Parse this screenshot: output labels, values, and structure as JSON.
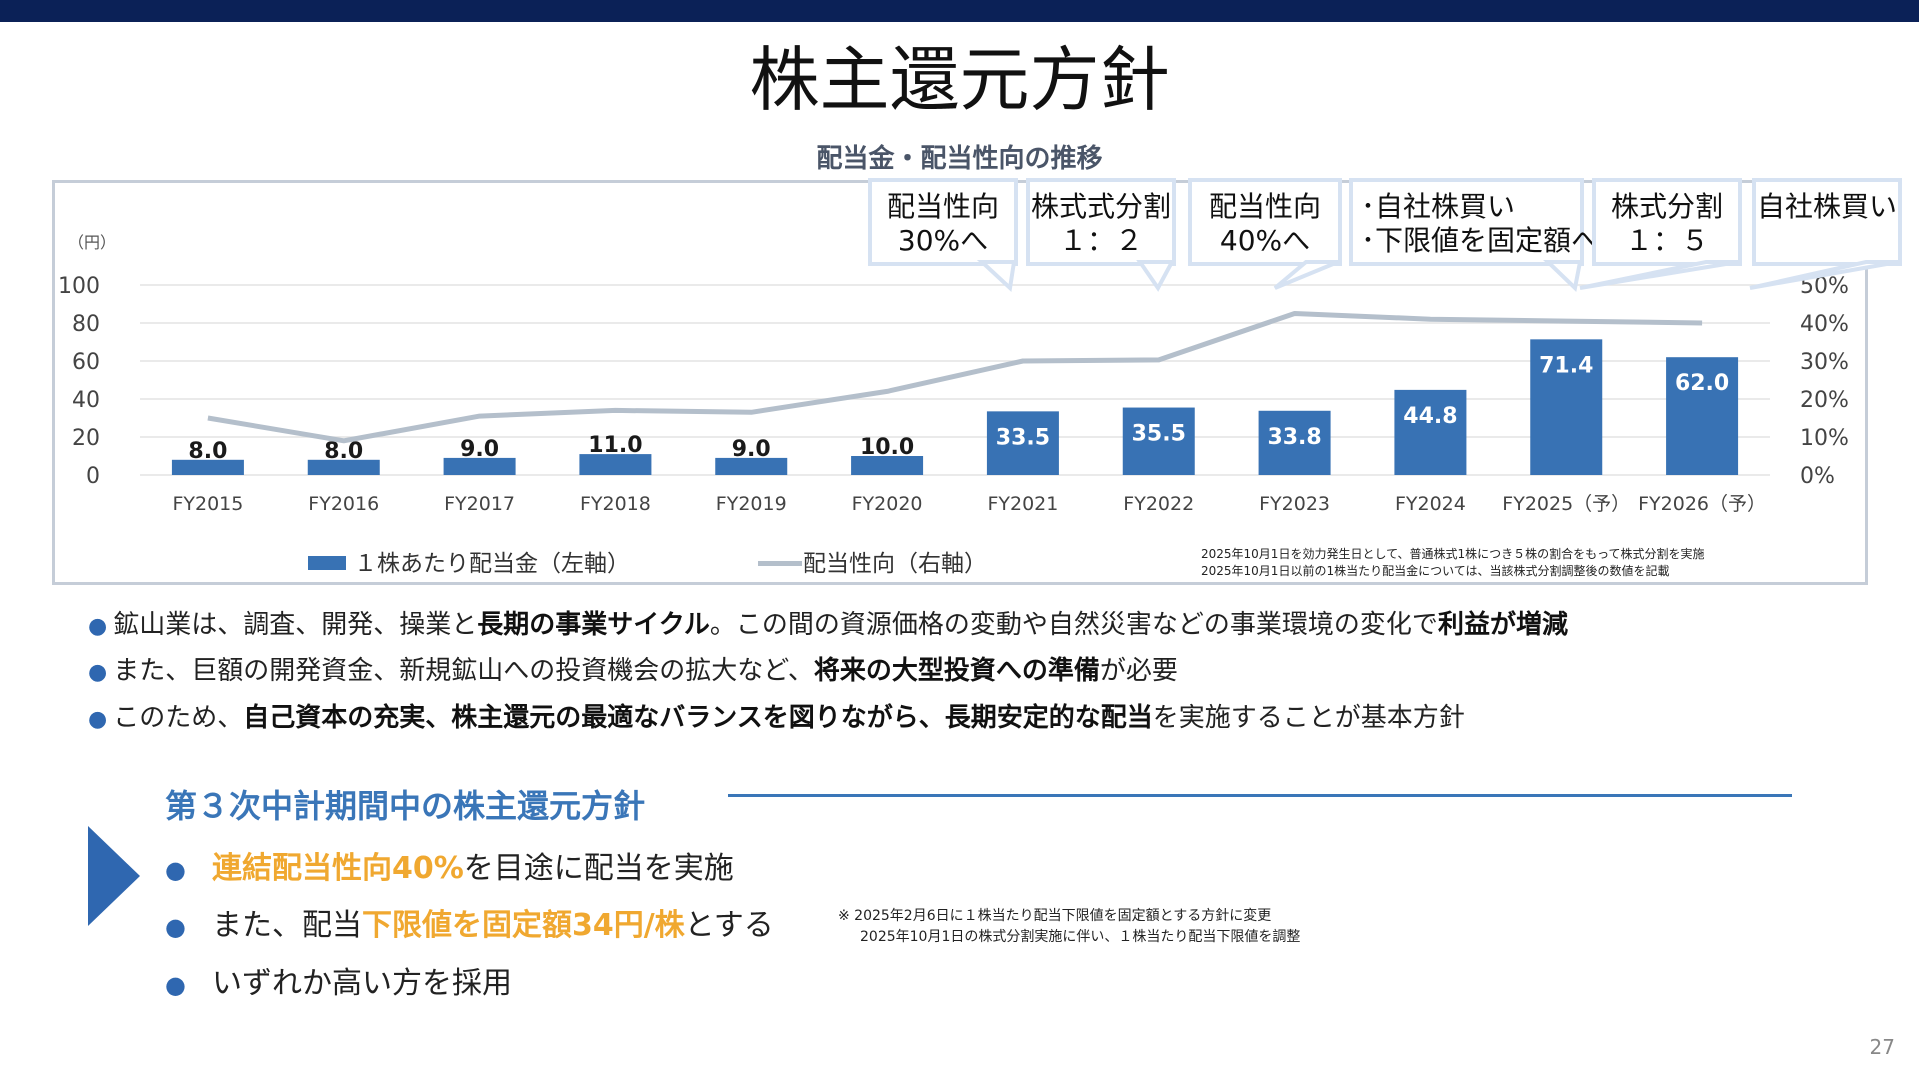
{
  "page": {
    "title": "株主還元方針",
    "page_number": "27"
  },
  "chart_section": {
    "title": "配当金・配当性向の推移",
    "left_axis_unit": "（円）",
    "callouts": [
      {
        "line1": "配当性向",
        "line2": "30%へ"
      },
      {
        "line1": "株式式分割",
        "line2": "１：２"
      },
      {
        "line1": "配当性向",
        "line2": "40%へ"
      },
      {
        "line1": "･自社株買い",
        "line2": "･下限値を固定額へ"
      },
      {
        "line1": "株式分割",
        "line2": "１：５"
      },
      {
        "line1": "自社株買い",
        "line2": ""
      }
    ],
    "legend": {
      "bar": "１株あたり配当金（左軸）",
      "line": "配当性向（右軸）"
    },
    "notes": [
      "2025年10月1日を効力発生日として、普通株式1株につき５株の割合をもって株式分割を実施",
      "2025年10月1日以前の1株当たり配当金については、当該株式分割調整後の数値を記載"
    ]
  },
  "chart_data": {
    "type": "bar",
    "categories": [
      "FY2015",
      "FY2016",
      "FY2017",
      "FY2018",
      "FY2019",
      "FY2020",
      "FY2021",
      "FY2022",
      "FY2023",
      "FY2024",
      "FY2025（予）",
      "FY2026（予）"
    ],
    "series": [
      {
        "name": "１株あたり配当金（左軸）",
        "type": "bar",
        "axis": "left",
        "color": "#3872b4",
        "values": [
          8.0,
          8.0,
          9.0,
          11.0,
          9.0,
          10.0,
          33.5,
          35.5,
          33.8,
          44.8,
          71.4,
          62.0
        ],
        "labels": [
          "8.0",
          "8.0",
          "9.0",
          "11.0",
          "9.0",
          "10.0",
          "33.5",
          "35.5",
          "33.8",
          "44.8",
          "71.4",
          "62.0"
        ]
      },
      {
        "name": "配当性向（右軸）",
        "type": "line",
        "axis": "right",
        "color": "#b4bfcb",
        "values": [
          15,
          9,
          15.5,
          17,
          16.5,
          22,
          30,
          30.3,
          42.5,
          41,
          40.5,
          40
        ]
      }
    ],
    "left_axis": {
      "ticks": [
        "0",
        "20",
        "40",
        "60",
        "80",
        "100"
      ],
      "ylim": [
        0,
        100
      ]
    },
    "right_axis": {
      "ticks": [
        "0%",
        "10%",
        "20%",
        "30%",
        "40%",
        "50%"
      ],
      "ylim": [
        0,
        50
      ]
    },
    "grid": true
  },
  "bullets": [
    {
      "parts": [
        {
          "t": "鉱山業は、調査、開発、操業と"
        },
        {
          "t": "長期の事業サイクル",
          "b": true
        },
        {
          "t": "。この間の資源価格の変動や自然災害などの事業環境の変化で"
        },
        {
          "t": "利益が増減",
          "b": true
        }
      ]
    },
    {
      "parts": [
        {
          "t": "また、巨額の開発資金、新規鉱山への投資機会の拡大など、"
        },
        {
          "t": "将来の大型投資への準備",
          "b": true
        },
        {
          "t": "が必要"
        }
      ]
    },
    {
      "parts": [
        {
          "t": "このため、"
        },
        {
          "t": "自己資本の充実、株主還元の最適なバランスを図りながら、長期安定的な配当",
          "b": true
        },
        {
          "t": "を実施することが基本方針"
        }
      ]
    }
  ],
  "policy_section": {
    "heading": "第３次中計期間中の株主還元方針",
    "items": [
      {
        "parts": [
          {
            "t": "連結配当性向40%",
            "h": true
          },
          {
            "t": "を目途に配当を実施"
          }
        ]
      },
      {
        "parts": [
          {
            "t": "また、配当"
          },
          {
            "t": "下限値を固定額34円/株",
            "h": true
          },
          {
            "t": "とする"
          }
        ]
      },
      {
        "parts": [
          {
            "t": "いずれか高い方を採用"
          }
        ]
      }
    ],
    "footnotes": [
      "※ 2025年2月6日に１株当たり配当下限値を固定額とする方針に変更",
      "2025年10月1日の株式分割実施に伴い、１株当たり配当下限値を調整"
    ]
  },
  "colors": {
    "accent": "#3a76b8",
    "highlight": "#f0a830",
    "bar": "#3872b4",
    "line": "#b4bfcb",
    "topbar": "#0b2157"
  }
}
